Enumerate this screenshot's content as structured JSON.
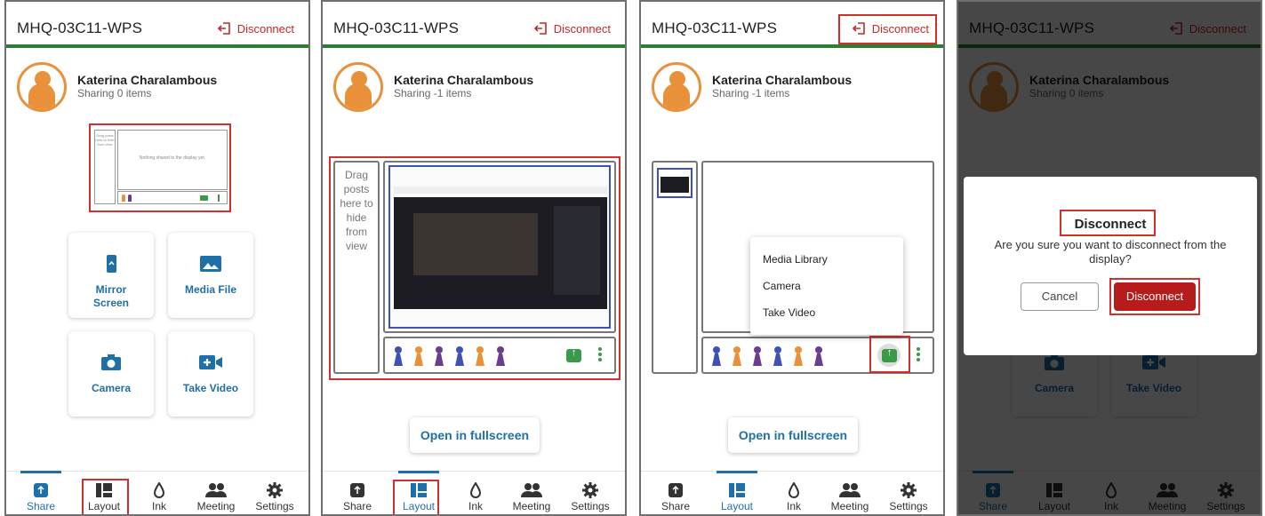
{
  "colors": {
    "accent": "#1f6fa8",
    "header_rule": "#2e7d32",
    "danger": "#c62828",
    "avatar": "#e8913a",
    "annotation": "#d32f2f"
  },
  "app": {
    "device_name": "MHQ-03C11-WPS",
    "disconnect_label": "Disconnect"
  },
  "user": {
    "name": "Katerina Charalambous",
    "sharing_zero": "Sharing 0 items",
    "sharing_neg": "Sharing -1 items"
  },
  "mini_display": {
    "drag_text": "Drag posts here to hide from view",
    "empty_text": "Nothing shared to the display yet."
  },
  "share_tiles": {
    "mirror": "Mirror Screen",
    "media": "Media File",
    "camera": "Camera",
    "video": "Take Video"
  },
  "layout": {
    "drag_lines": [
      "Drag",
      "posts",
      "here to",
      "hide",
      "from",
      "view"
    ],
    "fullscreen": "Open in fullscreen"
  },
  "upload_menu": {
    "items": [
      "Media Library",
      "Camera",
      "Take Video"
    ]
  },
  "dialog": {
    "title": "Disconnect",
    "message": "Are you sure you want to disconnect from the display?",
    "cancel": "Cancel",
    "confirm": "Disconnect"
  },
  "tabs": {
    "share": "Share",
    "layout": "Layout",
    "ink": "Ink",
    "meeting": "Meeting",
    "settings": "Settings"
  },
  "icons": [
    "logout-icon",
    "upload-icon",
    "layout-grid-icon",
    "ink-drop-icon",
    "people-icon",
    "gear-icon",
    "phone-mirror-icon",
    "image-icon",
    "camera-icon",
    "video-camera-icon",
    "kebab-menu-icon"
  ]
}
